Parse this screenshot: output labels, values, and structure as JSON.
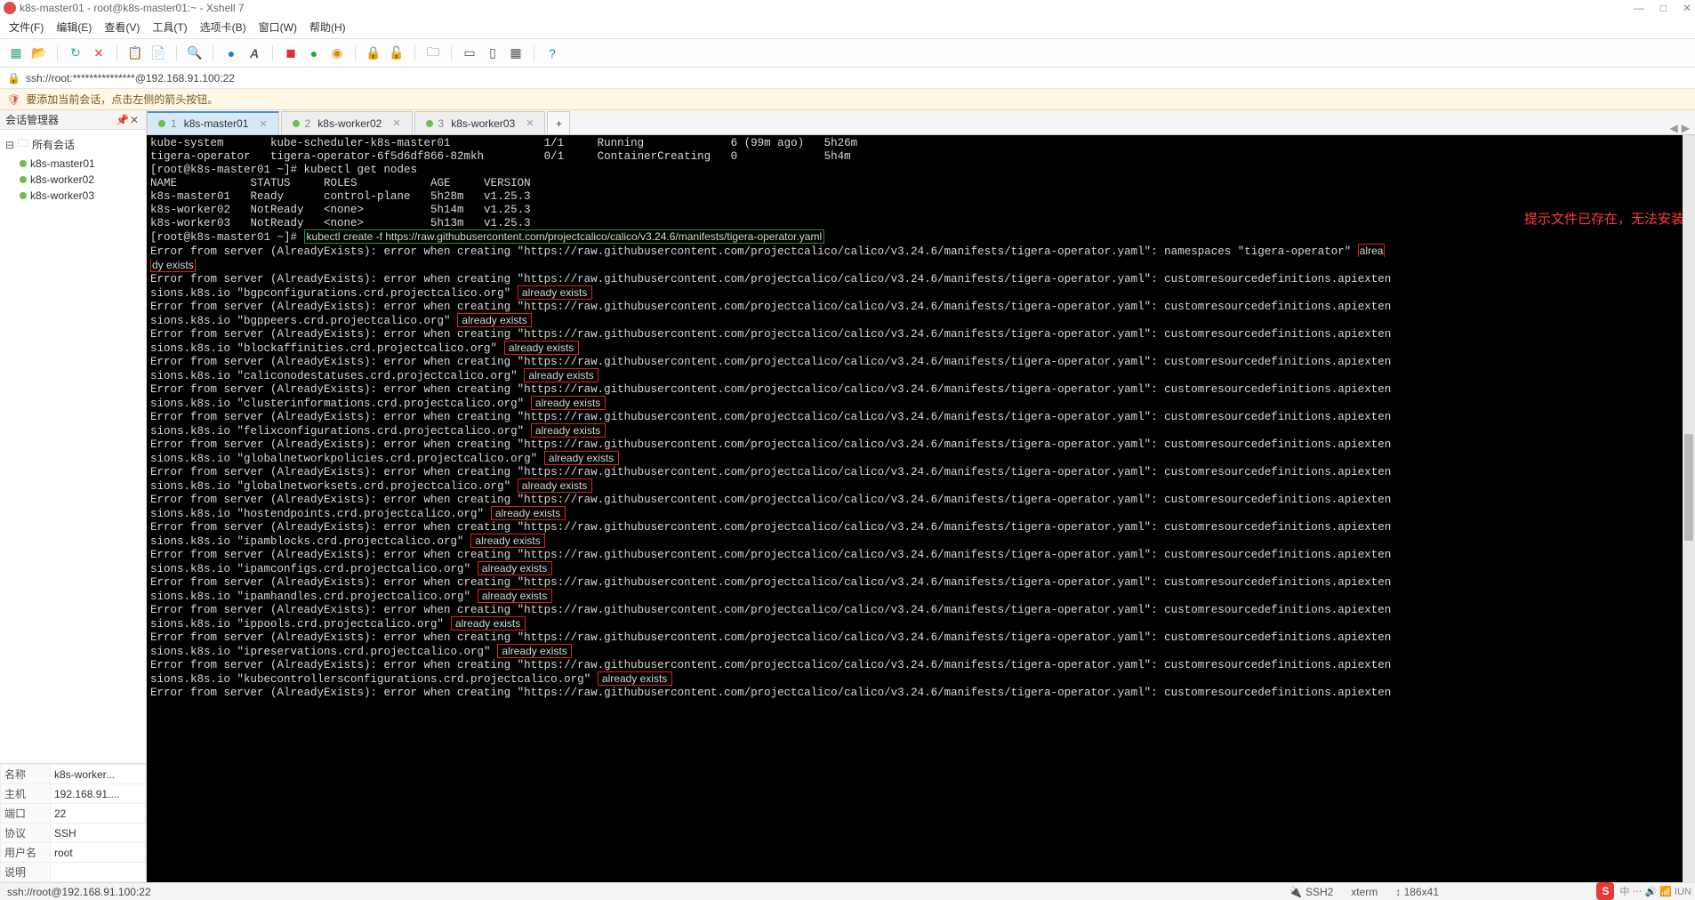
{
  "window": {
    "title": "k8s-master01 - root@k8s-master01:~ - Xshell 7",
    "min": "—",
    "max": "□",
    "close": "✕"
  },
  "menu": [
    "文件(F)",
    "编辑(E)",
    "查看(V)",
    "工具(T)",
    "选项卡(B)",
    "窗口(W)",
    "帮助(H)"
  ],
  "toolbar_icons": [
    "📄",
    "📂",
    "✂",
    "📋",
    "🔁",
    "🔍",
    "🌐",
    "A",
    "⬛",
    "🟢",
    "🔒",
    "🔓",
    "📁",
    "🔲",
    "🔳",
    "🗂",
    "❓"
  ],
  "address": "ssh://root:***************@192.168.91.100:22",
  "info_text": "要添加当前会话，点击左侧的箭头按钮。",
  "sidebar": {
    "title": "会话管理器",
    "root": "所有会话",
    "hosts": [
      "k8s-master01",
      "k8s-worker02",
      "k8s-worker03"
    ],
    "props": [
      {
        "k": "名称",
        "v": "k8s-worker..."
      },
      {
        "k": "主机",
        "v": "192.168.91...."
      },
      {
        "k": "端口",
        "v": "22"
      },
      {
        "k": "协议",
        "v": "SSH"
      },
      {
        "k": "用户名",
        "v": "root"
      },
      {
        "k": "说明",
        "v": ""
      }
    ]
  },
  "tabs": [
    {
      "num": "1",
      "label": "k8s-master01",
      "active": true
    },
    {
      "num": "2",
      "label": "k8s-worker02",
      "active": false
    },
    {
      "num": "3",
      "label": "k8s-worker03",
      "active": false
    }
  ],
  "annotation": "提示文件已存在，无法安装",
  "terminal": {
    "header_lines": [
      "kube-system       kube-scheduler-k8s-master01              1/1     Running             6 (99m ago)   5h26m",
      "tigera-operator   tigera-operator-6f5d6df866-82mkh         0/1     ContainerCreating   0             5h4m",
      "[root@k8s-master01 ~]# kubectl get nodes",
      "NAME           STATUS     ROLES           AGE     VERSION",
      "k8s-master01   Ready      control-plane   5h28m   v1.25.3",
      "k8s-worker02   NotReady   <none>          5h14m   v1.25.3",
      "k8s-worker03   NotReady   <none>          5h13m   v1.25.3"
    ],
    "prompt": "[root@k8s-master01 ~]# ",
    "command": "kubectl create -f https://raw.githubusercontent.com/projectcalico/calico/v3.24.6/manifests/tigera-operator.yaml",
    "err_url": "https://raw.githubusercontent.com/projectcalico/calico/v3.24.6/manifests/tigera-operator.yaml",
    "first_err_pre": "Error from server (AlreadyExists): error when creating \"",
    "first_err_mid": "\": namespaces \"tigera-operator\" ",
    "first_err_hl1": "alrea",
    "first_err_hl2": "dy exists",
    "crd_prefix": "Error from server (AlreadyExists): error when creating \"",
    "crd_mid": "\": customresourcedefinitions.apiexten",
    "crd_line2a": "sions.k8s.io \"",
    "crd_line2b": "\" ",
    "crd_exists": "already exists",
    "crds": [
      "bgpconfigurations.crd.projectcalico.org",
      "bgppeers.crd.projectcalico.org",
      "blockaffinities.crd.projectcalico.org",
      "caliconodestatuses.crd.projectcalico.org",
      "clusterinformations.crd.projectcalico.org",
      "felixconfigurations.crd.projectcalico.org",
      "globalnetworkpolicies.crd.projectcalico.org",
      "globalnetworksets.crd.projectcalico.org",
      "hostendpoints.crd.projectcalico.org",
      "ipamblocks.crd.projectcalico.org",
      "ipamconfigs.crd.projectcalico.org",
      "ipamhandles.crd.projectcalico.org",
      "ippools.crd.projectcalico.org",
      "ipreservations.crd.projectcalico.org",
      "kubecontrollersconfigurations.crd.projectcalico.org"
    ],
    "trailing_partial": "Error from server (AlreadyExists): error when creating \"https://raw.githubusercontent.com/projectcalico/calico/v3.24.6/manifests/tigera-operator.yaml\": customresourcedefinitions.apiexten"
  },
  "status": {
    "left": "ssh://root@192.168.91.100:22",
    "ssh": "SSH2",
    "term": "xterm",
    "size": "↕ 186x41",
    "tray_text": "中 ⋯ 🔊 📶 IUN"
  }
}
